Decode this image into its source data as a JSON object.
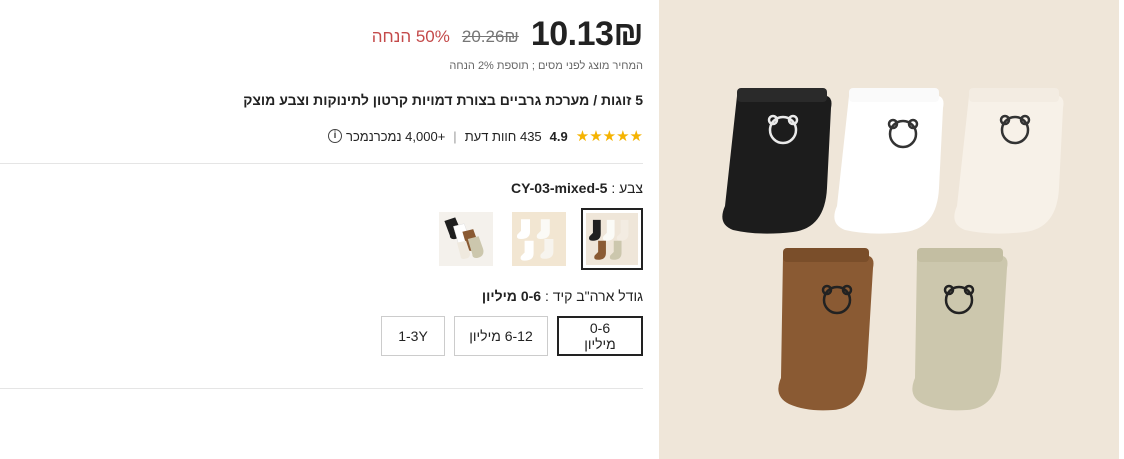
{
  "price": {
    "current": "10.13₪",
    "original": "20.26₪",
    "discount": "50% הנחה",
    "tax_note": "המחיר מוצג לפני מסים ; תוספת 2% הנחה"
  },
  "product": {
    "title": "5 זוגות / מערכת גרביים בצורת דמויות קרטון לתינוקות וצבע מוצק"
  },
  "rating": {
    "stars": "★★★★★",
    "value": "4.9",
    "reviews": "435 חוות דעת",
    "separator": "|",
    "sold": "+4,000 נמכרנמכר",
    "info_icon": "i"
  },
  "color": {
    "label": "צבע : ",
    "value": "CY-03-mixed-5",
    "options": [
      "CY-03-mixed-5",
      "white-mix",
      "neutral-mix"
    ]
  },
  "size": {
    "label": "גודל ארה\"ב קיד : ",
    "value": "0-6 מיליון",
    "options": [
      "0-6 מיליון",
      "6-12 מיליון",
      "1-3Y"
    ]
  },
  "image": {
    "background": "#efe6d9",
    "icon": "bear-socks-image"
  },
  "colors": {
    "text": "#222222",
    "muted": "#767676",
    "discount": "#c44a4a",
    "star": "#f5b301",
    "border": "#e5e5e5"
  }
}
